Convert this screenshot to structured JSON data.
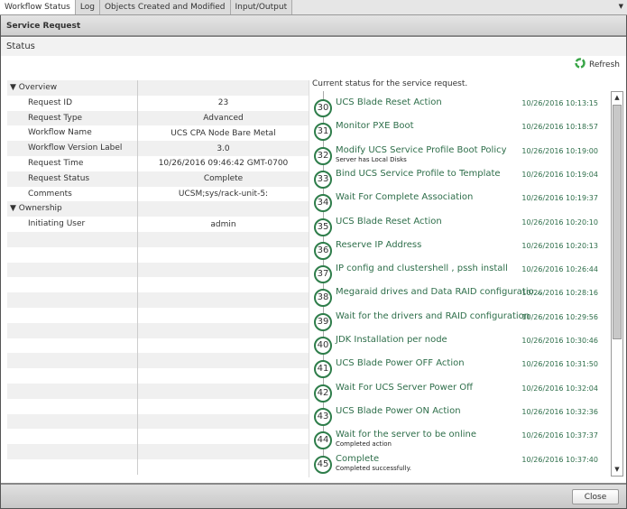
{
  "tabs": [
    "Workflow Status",
    "Log",
    "Objects Created and Modified",
    "Input/Output"
  ],
  "header": "Service Request",
  "status_title": "Status",
  "refresh": "Refresh",
  "current_status": "Current status for the service request.",
  "overview": {
    "label": "▼ Overview",
    "rows": [
      {
        "k": "Request ID",
        "v": "23"
      },
      {
        "k": "Request Type",
        "v": "Advanced"
      },
      {
        "k": "Workflow Name",
        "v": "UCS CPA Node Bare Metal"
      },
      {
        "k": "Workflow Version Label",
        "v": "3.0"
      },
      {
        "k": "Request Time",
        "v": "10/26/2016 09:46:42 GMT-0700"
      },
      {
        "k": "Request Status",
        "v": "Complete"
      },
      {
        "k": "Comments",
        "v": "UCSM;sys/rack-unit-5:"
      }
    ]
  },
  "ownership": {
    "label": "▼ Ownership",
    "rows": [
      {
        "k": "Initiating User",
        "v": "admin"
      }
    ]
  },
  "steps": [
    {
      "n": "30",
      "name": "UCS Blade Reset Action",
      "sub": "",
      "time": "10/26/2016 10:13:15"
    },
    {
      "n": "31",
      "name": "Monitor PXE Boot",
      "sub": "",
      "time": "10/26/2016 10:18:57"
    },
    {
      "n": "32",
      "name": "Modify UCS Service Profile Boot Policy",
      "sub": "Server has Local Disks",
      "time": "10/26/2016 10:19:00"
    },
    {
      "n": "33",
      "name": "Bind UCS Service Profile to Template",
      "sub": "",
      "time": "10/26/2016 10:19:04"
    },
    {
      "n": "34",
      "name": "Wait For Complete Association",
      "sub": "",
      "time": "10/26/2016 10:19:37"
    },
    {
      "n": "35",
      "name": "UCS Blade Reset Action",
      "sub": "",
      "time": "10/26/2016 10:20:10"
    },
    {
      "n": "36",
      "name": "Reserve IP Address",
      "sub": "",
      "time": "10/26/2016 10:20:13"
    },
    {
      "n": "37",
      "name": "IP config and clustershell , pssh install",
      "sub": "",
      "time": "10/26/2016 10:26:44"
    },
    {
      "n": "38",
      "name": "Megaraid drives and Data RAID configuratio...",
      "sub": "",
      "time": "10/26/2016 10:28:16"
    },
    {
      "n": "39",
      "name": "Wait for the drivers and RAID configuration",
      "sub": "",
      "time": "10/26/2016 10:29:56"
    },
    {
      "n": "40",
      "name": "JDK Installation per node",
      "sub": "",
      "time": "10/26/2016 10:30:46"
    },
    {
      "n": "41",
      "name": "UCS Blade Power OFF Action",
      "sub": "",
      "time": "10/26/2016 10:31:50"
    },
    {
      "n": "42",
      "name": "Wait For UCS Server Power Off",
      "sub": "",
      "time": "10/26/2016 10:32:04"
    },
    {
      "n": "43",
      "name": "UCS Blade Power ON Action",
      "sub": "",
      "time": "10/26/2016 10:32:36"
    },
    {
      "n": "44",
      "name": "Wait for the server to be online",
      "sub": "Completed action",
      "time": "10/26/2016 10:37:37"
    },
    {
      "n": "45",
      "name": "Complete",
      "sub": "Completed successfully.",
      "time": "10/26/2016 10:37:40"
    }
  ],
  "close": "Close"
}
